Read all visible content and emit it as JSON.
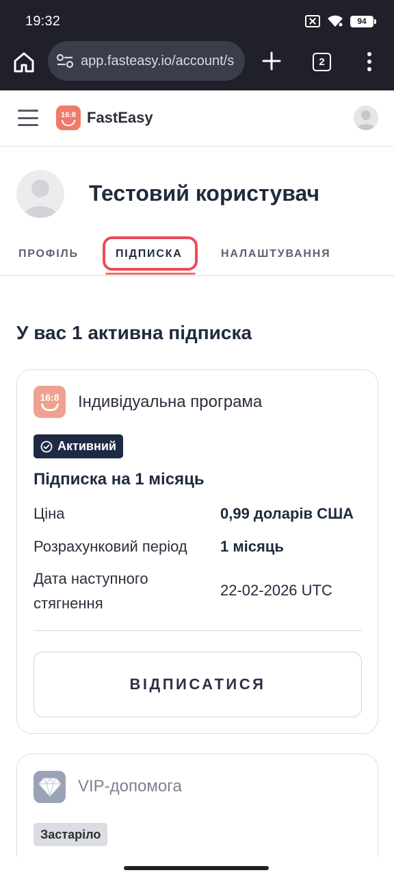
{
  "status_bar": {
    "time": "19:32",
    "battery": "94"
  },
  "browser": {
    "url": "app.fasteasy.io/account/s",
    "tab_count": "2"
  },
  "app_header": {
    "brand": "FastEasy",
    "logo_text": "16:8"
  },
  "profile": {
    "name": "Тестовий користувач"
  },
  "tabs": [
    {
      "label": "ПРОФІЛЬ"
    },
    {
      "label": "ПІДПИСКА"
    },
    {
      "label": "НАЛАШТУВАННЯ"
    }
  ],
  "content": {
    "title": "У вас 1 активна підписка",
    "subscription": {
      "logo_text": "16:8",
      "title": "Індивідуальна програма",
      "status": "Активний",
      "plan": "Підписка на 1 місяць",
      "rows": [
        {
          "label": "Ціна",
          "value": "0,99 доларів США"
        },
        {
          "label": "Розрахунковий період",
          "value": "1 місяць"
        },
        {
          "label": "Дата наступного стягнення",
          "value": "22-02-2026 UTC"
        }
      ],
      "unsubscribe_label": "ВІДПИСАТИСЯ"
    },
    "vip": {
      "title": "VIP-допомога",
      "status": "Застаріло"
    }
  },
  "colors": {
    "chrome_bg": "#1f2029",
    "accent": "#ef6f6a",
    "highlight": "#ee4a55",
    "badge_active": "#1f2a44"
  }
}
